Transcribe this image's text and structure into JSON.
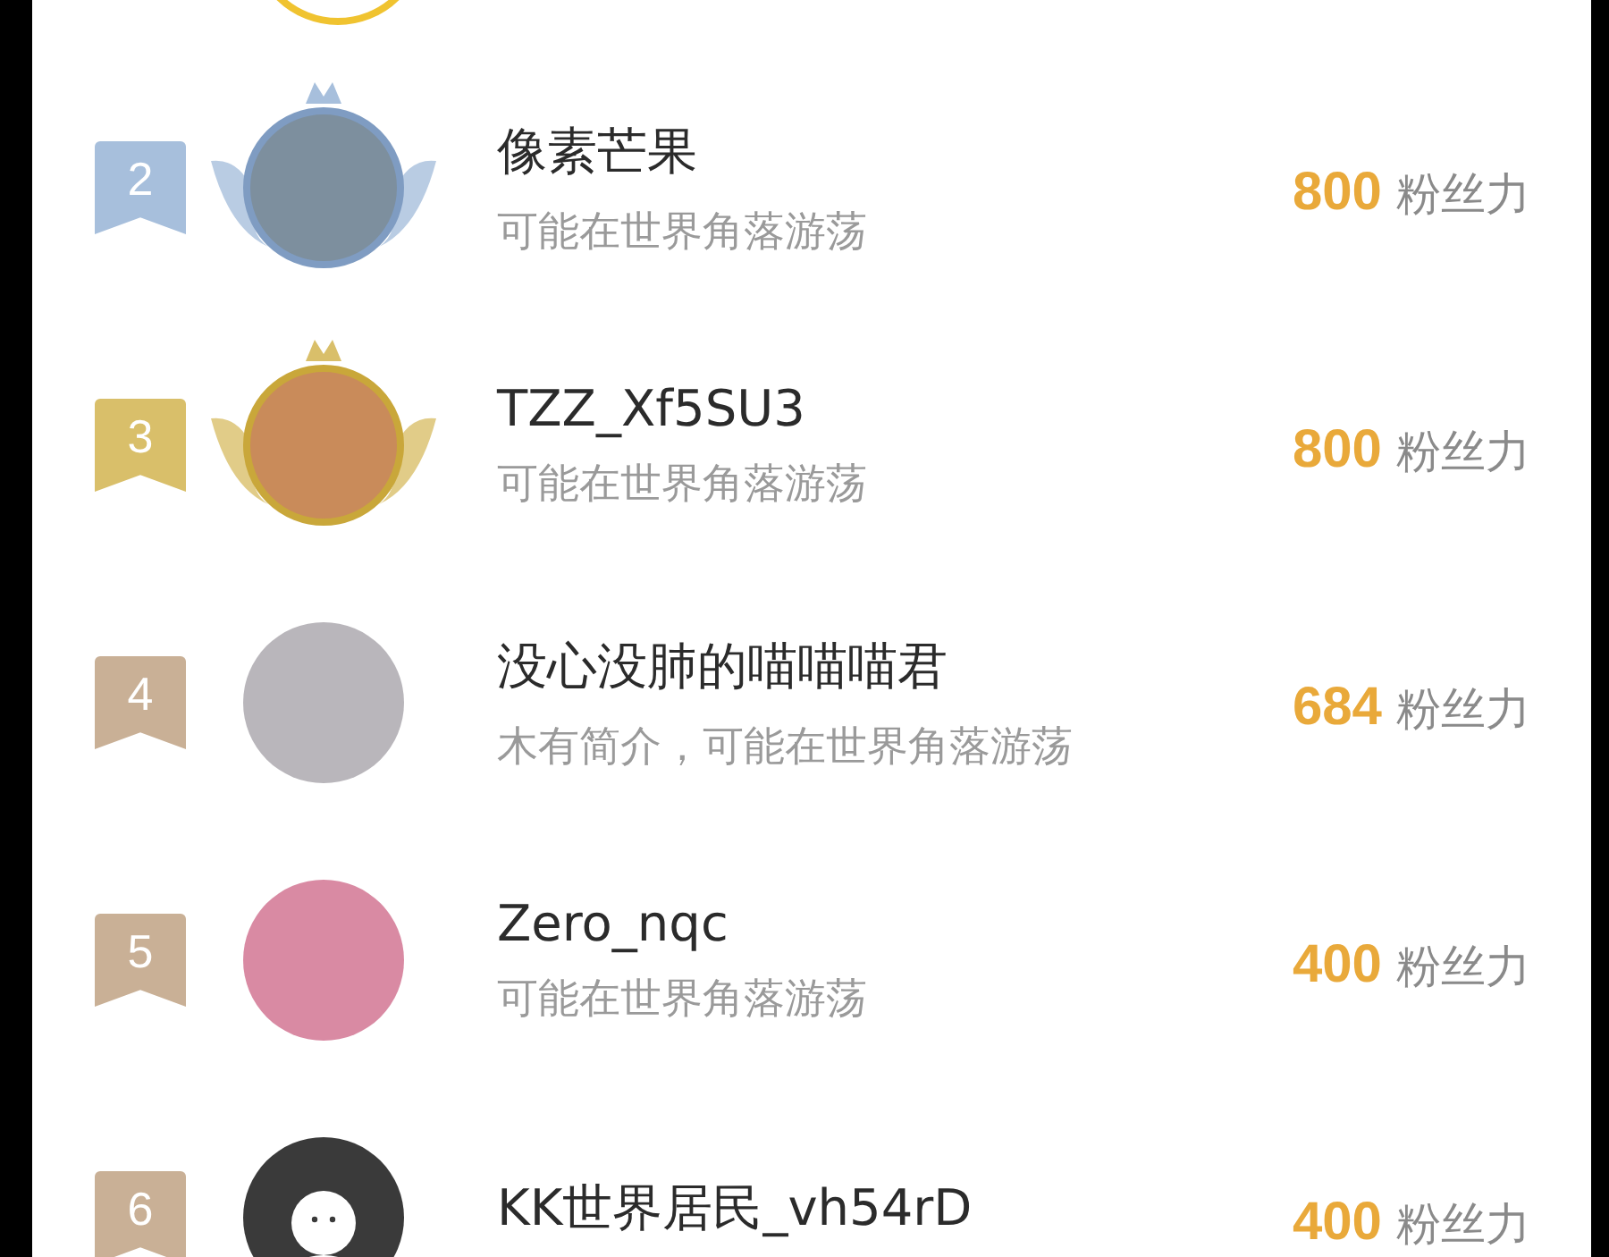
{
  "ranking": [
    {
      "rank": "2",
      "kind": "silver",
      "name": "像素芒果",
      "bio": "可能在世界角落游荡",
      "score": "800",
      "unit": "粉丝力"
    },
    {
      "rank": "3",
      "kind": "gold",
      "name": "TZZ_Xf5SU3",
      "bio": "可能在世界角落游荡",
      "score": "800",
      "unit": "粉丝力"
    },
    {
      "rank": "4",
      "kind": "plain",
      "name": "没心没肺的喵喵喵君",
      "bio": "木有简介，可能在世界角落游荡",
      "score": "684",
      "unit": "粉丝力"
    },
    {
      "rank": "5",
      "kind": "plain",
      "name": "Zero_nqc",
      "bio": "可能在世界角落游荡",
      "score": "400",
      "unit": "粉丝力"
    },
    {
      "rank": "6",
      "kind": "anonymous",
      "name": "KK世界居民_vh54rD",
      "score": "400",
      "unit": "粉丝力"
    }
  ]
}
